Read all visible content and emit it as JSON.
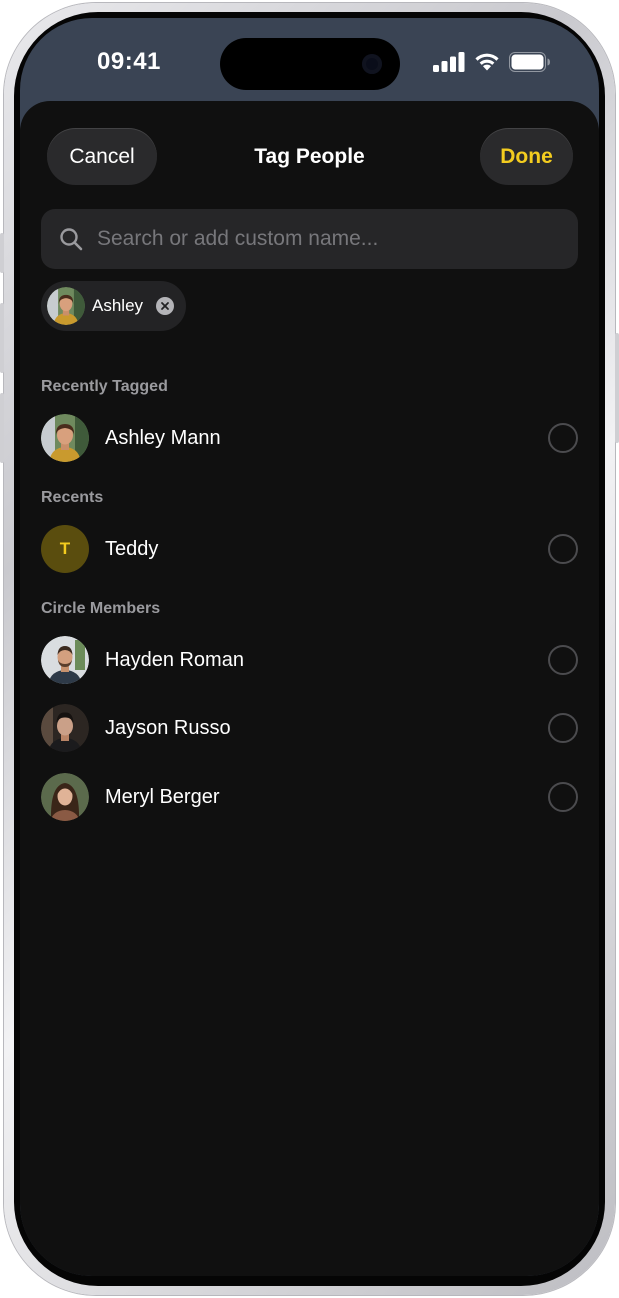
{
  "status_bar": {
    "time": "09:41"
  },
  "header": {
    "cancel_label": "Cancel",
    "title": "Tag People",
    "done_label": "Done"
  },
  "search": {
    "placeholder": "Search or add custom name..."
  },
  "selected_chip": {
    "label": "Ashley"
  },
  "sections": {
    "recently_tagged": {
      "title": "Recently Tagged",
      "people": [
        {
          "name": "Ashley Mann"
        }
      ]
    },
    "recents": {
      "title": "Recents",
      "people": [
        {
          "name": "Teddy",
          "initial": "T"
        }
      ]
    },
    "circle_members": {
      "title": "Circle Members",
      "people": [
        {
          "name": "Hayden Roman"
        },
        {
          "name": "Jayson Russo"
        },
        {
          "name": "Meryl Berger"
        }
      ]
    }
  },
  "colors": {
    "accent": "#f3cc1f",
    "sheet_bg": "#101010",
    "control_bg": "#2a2a2c",
    "muted_text": "#9a9a9e"
  },
  "icons": {
    "search": "magnifier-icon",
    "chip_remove": "close-icon",
    "signal": "cellular-signal-icon",
    "wifi": "wifi-icon",
    "battery": "battery-icon"
  }
}
